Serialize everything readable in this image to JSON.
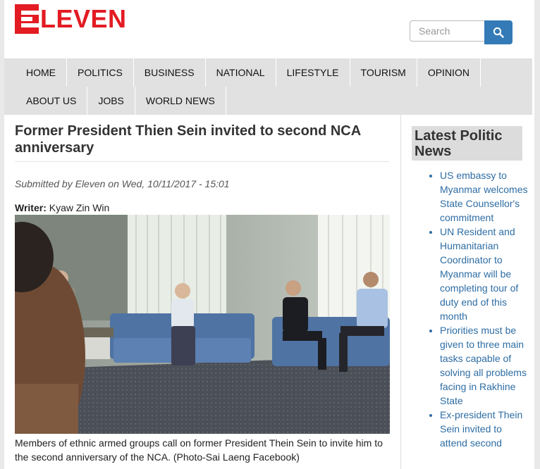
{
  "brand": {
    "logo_text": "LEVEN",
    "logo_letter": "E"
  },
  "search": {
    "placeholder": "Search",
    "icon": "search-icon"
  },
  "nav": {
    "row1": [
      "HOME",
      "POLITICS",
      "BUSINESS",
      "NATIONAL",
      "LIFESTYLE",
      "TOURISM",
      "OPINION"
    ],
    "row2": [
      "ABOUT US",
      "JOBS",
      "WORLD NEWS"
    ]
  },
  "article": {
    "title": "Former President Thien Sein invited to second NCA anniversary",
    "submitted": "Submitted by Eleven on Wed, 10/11/2017 - 15:01",
    "writer_label": "Writer:",
    "writer_name": "Kyaw Zin Win",
    "caption": "Members of ethnic armed groups call on former President Thein Sein to invite him to the second anniversary of the NCA. (Photo-Sai Laeng Facebook)"
  },
  "sidebar": {
    "title": "Latest Politic News",
    "items": [
      "US embassy to Myanmar welcomes State Counsellor's commitment",
      "UN Resident and Humanitarian Coordinator to Myanmar will be completing tour of duty end of this month",
      "Priorities must be given to three main tasks capable of solving all problems facing in Rakhine State",
      "Ex-president Thein Sein invited to attend second"
    ]
  },
  "colors": {
    "brand_red": "#e31b23",
    "link_blue": "#2e6da4",
    "button_blue": "#337ab7",
    "nav_bg": "#e1e1e1"
  }
}
